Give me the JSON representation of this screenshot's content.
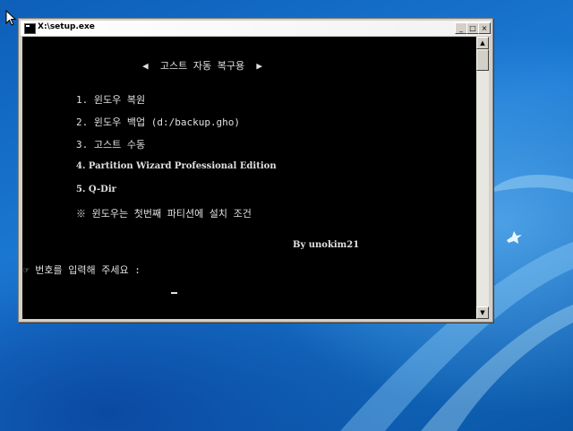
{
  "window": {
    "title": "X:\\setup.exe",
    "buttons": {
      "minimize": "_",
      "maximize": "□",
      "close": "×"
    }
  },
  "console": {
    "header": "◀  고스트 자동 복구용  ▶",
    "menu": [
      "1. 윈도우 복원",
      "2. 윈도우 백업 (d:/backup.gho)",
      "3. 고스트 수동",
      "4. Partition Wizard Professional Edition",
      "5. Q-Dir"
    ],
    "note": "※ 윈도우는 첫번째 파티션에 설치 조건",
    "credit": "By unokim21",
    "prompt": "☞ 번호를 입력해 주세요 :"
  },
  "scrollbar": {
    "up": "▲",
    "down": "▼"
  }
}
